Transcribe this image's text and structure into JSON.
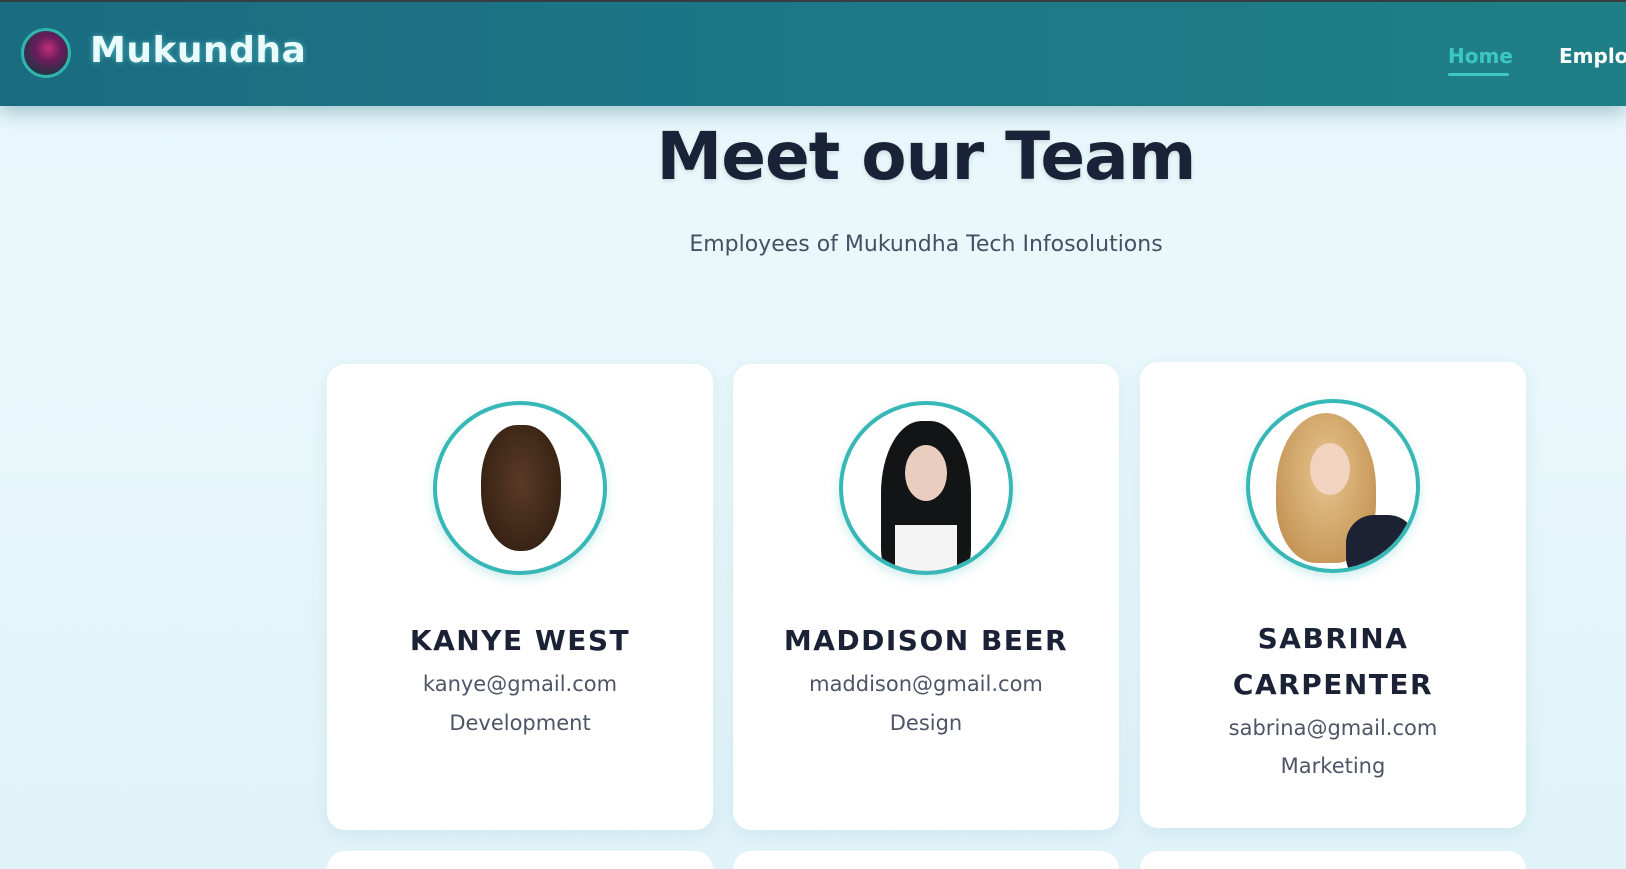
{
  "header": {
    "brand": "Mukundha",
    "nav": [
      {
        "label": "Home",
        "active": true
      },
      {
        "label": "Emplo",
        "active": false
      }
    ]
  },
  "hero": {
    "title": "Meet our Team",
    "subtitle": "Employees of Mukundha Tech Infosolutions"
  },
  "team": [
    {
      "name": "KANYE WEST",
      "email": "kanye@gmail.com",
      "department": "Development",
      "avatar_icon": "person-photo"
    },
    {
      "name": "MADDISON BEER",
      "email": "maddison@gmail.com",
      "department": "Design",
      "avatar_icon": "person-photo"
    },
    {
      "name": "SABRINA CARPENTER",
      "email": "sabrina@gmail.com",
      "department": "Marketing",
      "avatar_icon": "person-photo"
    }
  ],
  "colors": {
    "header": "#1d7787",
    "accent": "#37b8b6",
    "title": "#1a2238"
  }
}
